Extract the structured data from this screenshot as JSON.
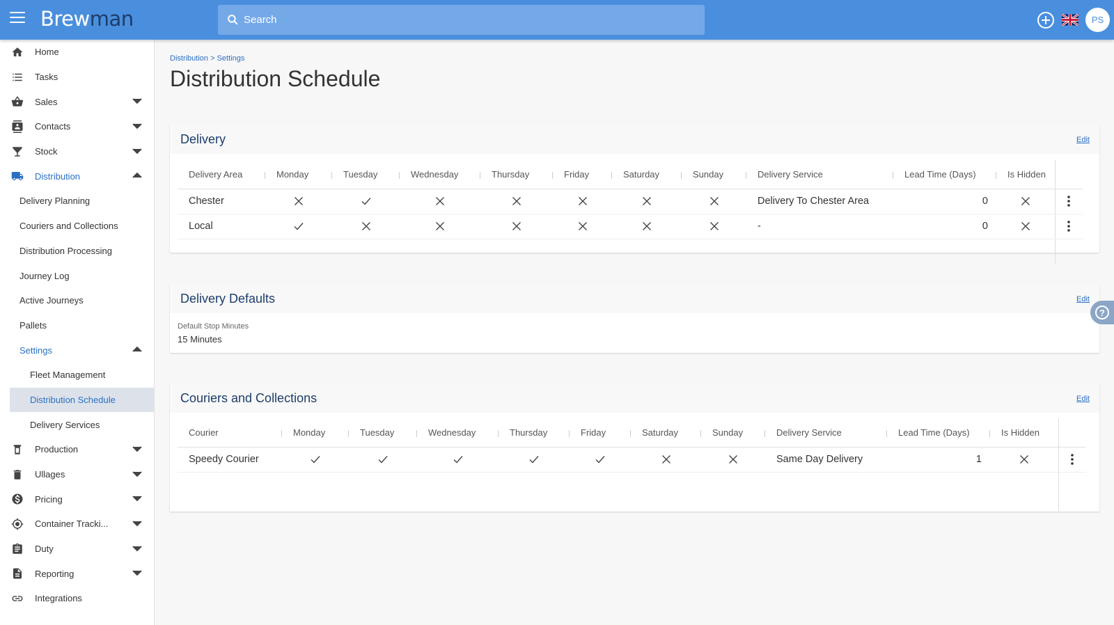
{
  "app": {
    "logo_part1": "Brew",
    "logo_part2": "man"
  },
  "header": {
    "search_placeholder": "Search",
    "avatar_initials": "PS",
    "language_flag": "uk-flag-icon"
  },
  "sidebar": {
    "items": [
      {
        "label": "Home",
        "icon": "home-icon"
      },
      {
        "label": "Tasks",
        "icon": "list-icon"
      },
      {
        "label": "Sales",
        "icon": "basket-icon"
      },
      {
        "label": "Contacts",
        "icon": "contacts-icon"
      },
      {
        "label": "Stock",
        "icon": "glass-icon"
      },
      {
        "label": "Distribution",
        "icon": "truck-icon"
      }
    ],
    "distribution_sub": [
      {
        "label": "Delivery Planning"
      },
      {
        "label": "Couriers and Collections"
      },
      {
        "label": "Distribution Processing"
      },
      {
        "label": "Journey Log"
      },
      {
        "label": "Active Journeys"
      },
      {
        "label": "Pallets"
      },
      {
        "label": "Settings"
      }
    ],
    "settings_sub": [
      {
        "label": "Fleet Management"
      },
      {
        "label": "Distribution Schedule"
      },
      {
        "label": "Delivery Services"
      }
    ],
    "lower_items": [
      {
        "label": "Production",
        "icon": "production-icon"
      },
      {
        "label": "Ullages",
        "icon": "trash-icon"
      },
      {
        "label": "Pricing",
        "icon": "dollar-icon"
      },
      {
        "label": "Container Tracki...",
        "icon": "target-icon"
      },
      {
        "label": "Duty",
        "icon": "clipboard-icon"
      },
      {
        "label": "Reporting",
        "icon": "report-icon"
      },
      {
        "label": "Integrations",
        "icon": "link-icon"
      }
    ]
  },
  "page": {
    "breadcrumb": {
      "parent": "Distribution",
      "separator": ">",
      "current": "Settings"
    },
    "title": "Distribution Schedule"
  },
  "delivery": {
    "title": "Delivery",
    "edit": "Edit",
    "columns": [
      "Delivery Area",
      "Monday",
      "Tuesday",
      "Wednesday",
      "Thursday",
      "Friday",
      "Saturday",
      "Sunday",
      "Delivery Service",
      "Lead Time (Days)",
      "Is Hidden"
    ],
    "rows": [
      {
        "area": "Chester",
        "days": [
          false,
          true,
          false,
          false,
          false,
          false,
          false
        ],
        "service": "Delivery To Chester Area",
        "lead_time": "0",
        "hidden": false
      },
      {
        "area": "Local",
        "days": [
          true,
          false,
          false,
          false,
          false,
          false,
          false
        ],
        "service": "-",
        "lead_time": "0",
        "hidden": false
      }
    ]
  },
  "defaults": {
    "title": "Delivery Defaults",
    "edit": "Edit",
    "stop_minutes_label": "Default Stop Minutes",
    "stop_minutes_value": "15 Minutes"
  },
  "couriers": {
    "title": "Couriers and Collections",
    "edit": "Edit",
    "columns": [
      "Courier",
      "Monday",
      "Tuesday",
      "Wednesday",
      "Thursday",
      "Friday",
      "Saturday",
      "Sunday",
      "Delivery Service",
      "Lead Time (Days)",
      "Is Hidden"
    ],
    "rows": [
      {
        "courier": "Speedy Courier",
        "days": [
          true,
          true,
          true,
          true,
          true,
          false,
          false
        ],
        "service": "Same Day Delivery",
        "lead_time": "1",
        "hidden": false
      }
    ]
  },
  "help": {
    "label": "?"
  }
}
